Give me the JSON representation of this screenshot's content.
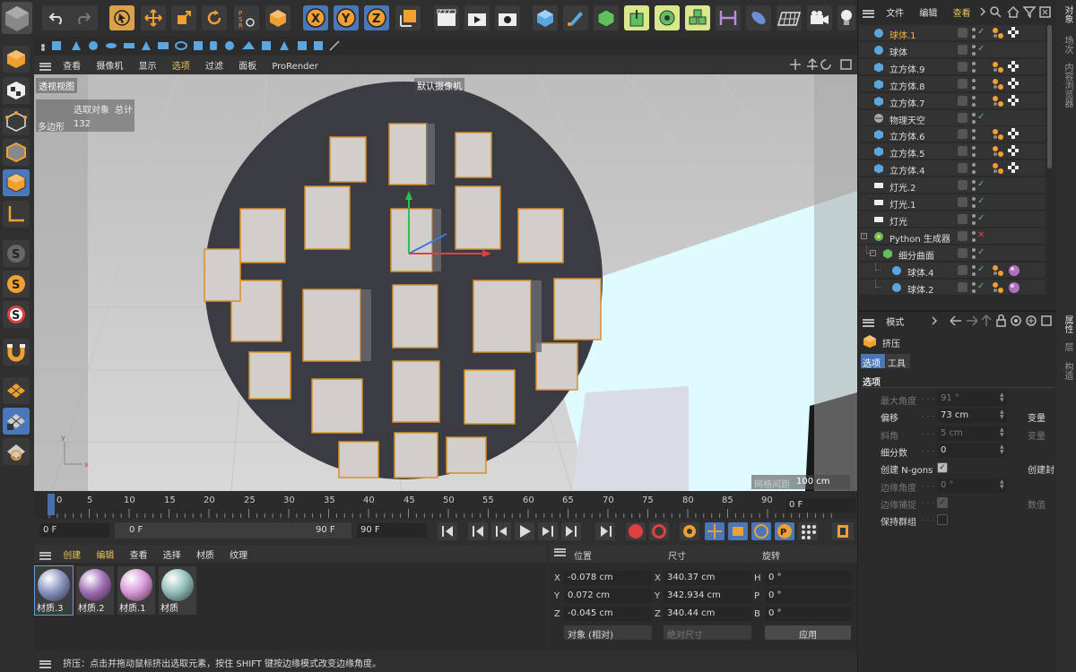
{
  "colors": {
    "accent": "#e08a00",
    "active_icon_bg": "#d9a24a",
    "viewport_bg": "#a9a9a9",
    "selected_tab": "#e6c45c",
    "check": "#5ec15e",
    "cross": "#e04040",
    "blue_btn": "#4a77b8"
  },
  "top_toolbar": {
    "icons": [
      "undo-icon",
      "redo-icon",
      "select-cursor-icon",
      "move-icon",
      "scale-icon",
      "rotate-icon",
      "psr-icon",
      "object-icon",
      "x-axis-icon",
      "y-axis-icon",
      "z-axis-icon",
      "coordinate-system-icon",
      "render-view-icon",
      "render-picture-icon",
      "render-settings-icon",
      "cube-icon",
      "pen-icon",
      "subdivision-icon",
      "extrude-icon",
      "cloner-icon",
      "mograph-icon",
      "deformer-icon",
      "environment-icon",
      "floor-icon",
      "camera-icon",
      "light-icon"
    ]
  },
  "viewport_menu": {
    "items": [
      "查看",
      "摄像机",
      "显示",
      "选项",
      "过滤",
      "面板",
      "ProRender"
    ]
  },
  "viewport": {
    "view_name": "透视视图",
    "camera_name": "默认摄像机",
    "hud_labels": [
      "选取对象",
      "总计"
    ],
    "hud_row_label": "多边形",
    "hud_row_value": "132",
    "grid_spacing_label": "网格间距",
    "grid_spacing_value": "100 cm"
  },
  "timeline": {
    "ticks": [
      "0",
      "5",
      "10",
      "15",
      "20",
      "25",
      "30",
      "35",
      "40",
      "45",
      "50",
      "55",
      "60",
      "65",
      "70",
      "75",
      "80",
      "85",
      "90"
    ],
    "current_frame_field": "0 F",
    "start_field": "0 F",
    "range_left": "0 F",
    "range_right": "90 F",
    "end_field": "90 F"
  },
  "material_panel": {
    "menu": [
      "创建",
      "编辑",
      "查看",
      "选择",
      "材质",
      "纹理"
    ],
    "materials": [
      {
        "name": "材质.3",
        "color": "#8a95c0"
      },
      {
        "name": "材质.2",
        "color": "#a070b5"
      },
      {
        "name": "材质.1",
        "color": "#d89ad8"
      },
      {
        "name": "材质",
        "color": "#95bfbb"
      }
    ]
  },
  "coords_panel": {
    "headers": [
      "位置",
      "尺寸",
      "旋转"
    ],
    "rows": [
      {
        "axis": "X",
        "pos": "-0.078 cm",
        "size_axis": "X",
        "size": "340.37 cm",
        "rot_axis": "H",
        "rot": "0 °"
      },
      {
        "axis": "Y",
        "pos": "0.072 cm",
        "size_axis": "Y",
        "size": "342.934 cm",
        "rot_axis": "P",
        "rot": "0 °"
      },
      {
        "axis": "Z",
        "pos": "-0.045 cm",
        "size_axis": "Z",
        "size": "340.44 cm",
        "rot_axis": "B",
        "rot": "0 °"
      }
    ],
    "mode_select": "对象 (相对)",
    "size_select": "绝对尺寸",
    "apply_label": "应用"
  },
  "status_bar": {
    "text": "挤压：点击并拖动鼠标挤出选取元素，按住 SHIFT 键按边缘模式改变边缘角度。"
  },
  "object_manager": {
    "menu": [
      "文件",
      "编辑",
      "查看"
    ],
    "side_tabs": [
      "对象",
      "场次",
      "内容浏览器"
    ],
    "objects": [
      {
        "name": "球体.1",
        "indent": 0,
        "selected": true,
        "status": "tick",
        "tags": [
          "phong",
          "checker"
        ]
      },
      {
        "name": "球体",
        "indent": 0,
        "status": "tick",
        "tags": []
      },
      {
        "name": "立方体.9",
        "indent": 0,
        "status": "none",
        "tags": [
          "phong",
          "checker"
        ]
      },
      {
        "name": "立方体.8",
        "indent": 0,
        "status": "none",
        "tags": [
          "phong",
          "checker"
        ]
      },
      {
        "name": "立方体.7",
        "indent": 0,
        "status": "none",
        "tags": [
          "phong",
          "checker"
        ]
      },
      {
        "name": "物理天空",
        "indent": 0,
        "status": "tick",
        "tags": []
      },
      {
        "name": "立方体.6",
        "indent": 0,
        "status": "none",
        "tags": [
          "phong",
          "checker"
        ]
      },
      {
        "name": "立方体.5",
        "indent": 0,
        "status": "none",
        "tags": [
          "phong",
          "checker"
        ]
      },
      {
        "name": "立方体.4",
        "indent": 0,
        "status": "none",
        "tags": [
          "phong",
          "checker"
        ]
      },
      {
        "name": "灯光.2",
        "indent": 0,
        "status": "tick",
        "tags": []
      },
      {
        "name": "灯光.1",
        "indent": 0,
        "status": "tick",
        "tags": []
      },
      {
        "name": "灯光",
        "indent": 0,
        "status": "tick",
        "tags": []
      },
      {
        "name": "Python 生成器",
        "indent": 0,
        "status": "cross",
        "tags": []
      },
      {
        "name": "细分曲面",
        "indent": 1,
        "status": "tick",
        "tags": []
      },
      {
        "name": "球体.4",
        "indent": 2,
        "status": "tick",
        "tags": [
          "phong",
          "material"
        ]
      },
      {
        "name": "球体.2",
        "indent": 2,
        "status": "tick",
        "tags": [
          "phong",
          "material"
        ]
      }
    ]
  },
  "attribute_manager": {
    "menu": "模式",
    "side_tabs": [
      "属性",
      "层",
      "构造"
    ],
    "tool_name": "挤压",
    "tabs": [
      "选项",
      "工具"
    ],
    "section": "选项",
    "rows": [
      {
        "label": "最大角度",
        "value": "91 °",
        "disabled": true,
        "right": ""
      },
      {
        "label": "偏移",
        "value": "73 cm",
        "disabled": false,
        "right": "变量"
      },
      {
        "label": "斜角",
        "value": "5 cm",
        "disabled": true,
        "right": "变量"
      },
      {
        "label": "细分数",
        "value": "0",
        "disabled": false,
        "right": ""
      },
      {
        "label": "创建 N-gons",
        "checkbox": true,
        "checked": true,
        "disabled": false,
        "right": "创建封"
      },
      {
        "label": "边缘角度",
        "value": "0 °",
        "disabled": true,
        "right": ""
      },
      {
        "label": "边缘捕捉",
        "checkbox": true,
        "checked": true,
        "disabled": true,
        "right": "数值"
      },
      {
        "label": "保持群组",
        "checkbox": true,
        "checked": false,
        "disabled": false,
        "right": ""
      }
    ]
  }
}
